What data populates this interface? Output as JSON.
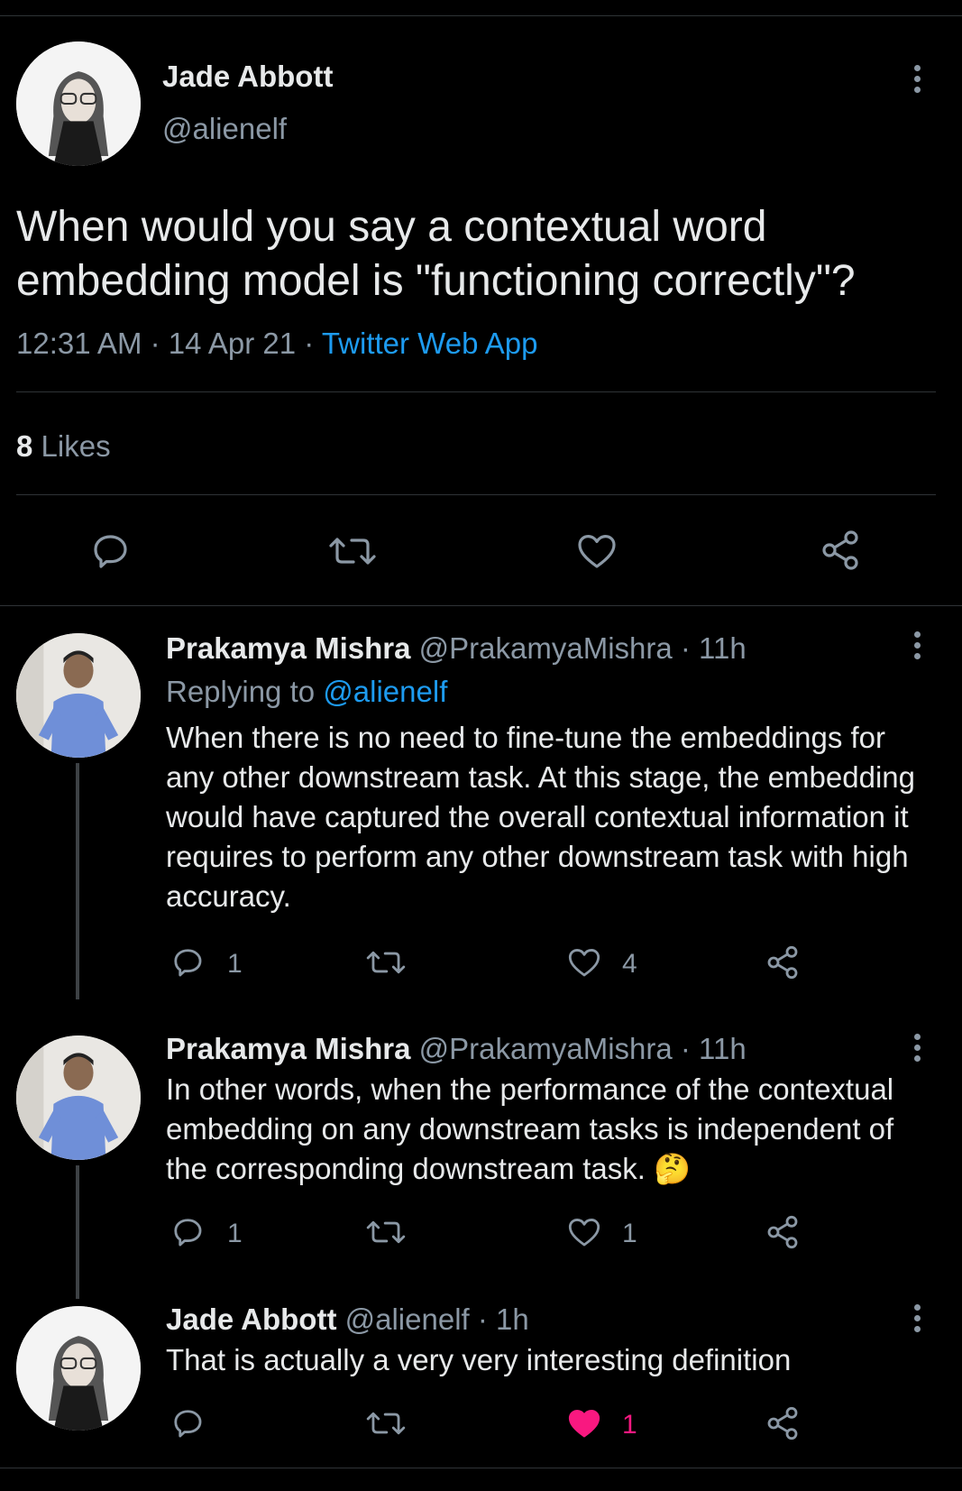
{
  "main_tweet": {
    "author_name": "Jade Abbott",
    "author_handle": "@alienelf",
    "text": "When would you say a contextual word embedding model is \"functioning correctly\"?",
    "time": "12:31 AM",
    "sep1": "·",
    "date": "14 Apr 21",
    "sep2": "·",
    "source": "Twitter Web App",
    "likes_count": "8",
    "likes_label": "Likes"
  },
  "replies": [
    {
      "author_name": "Prakamya Mishra",
      "meta": "@PrakamyaMishra · 11h",
      "replying_prefix": "Replying to",
      "replying_handle": "@alienelf",
      "text": "When there is no need to fine-tune the embeddings for any other downstream task. At this stage, the embedding would have captured the overall contextual information it requires to perform any other downstream task with high accuracy.",
      "reply_count": "1",
      "like_count": "4"
    },
    {
      "author_name": "Prakamya Mishra",
      "meta": "@PrakamyaMishra · 11h",
      "text": "In other words, when the performance of the contextual embedding on any downstream tasks is independent of the corresponding downstream task.",
      "emoji": "🤔",
      "reply_count": "1",
      "like_count": "1"
    },
    {
      "author_name": "Jade Abbott",
      "meta": "@alienelf · 1h",
      "text": "That is actually a very very interesting definition",
      "like_count": "1",
      "liked": true
    }
  ],
  "colors": {
    "background": "#000000",
    "text": "#e7e9ea",
    "muted": "#8b98a5",
    "accent": "#1d9bf0",
    "like_active": "#f91880",
    "divider": "#2f3336"
  },
  "icons": [
    "reply-icon",
    "retweet-icon",
    "like-icon",
    "share-icon",
    "more-icon"
  ]
}
